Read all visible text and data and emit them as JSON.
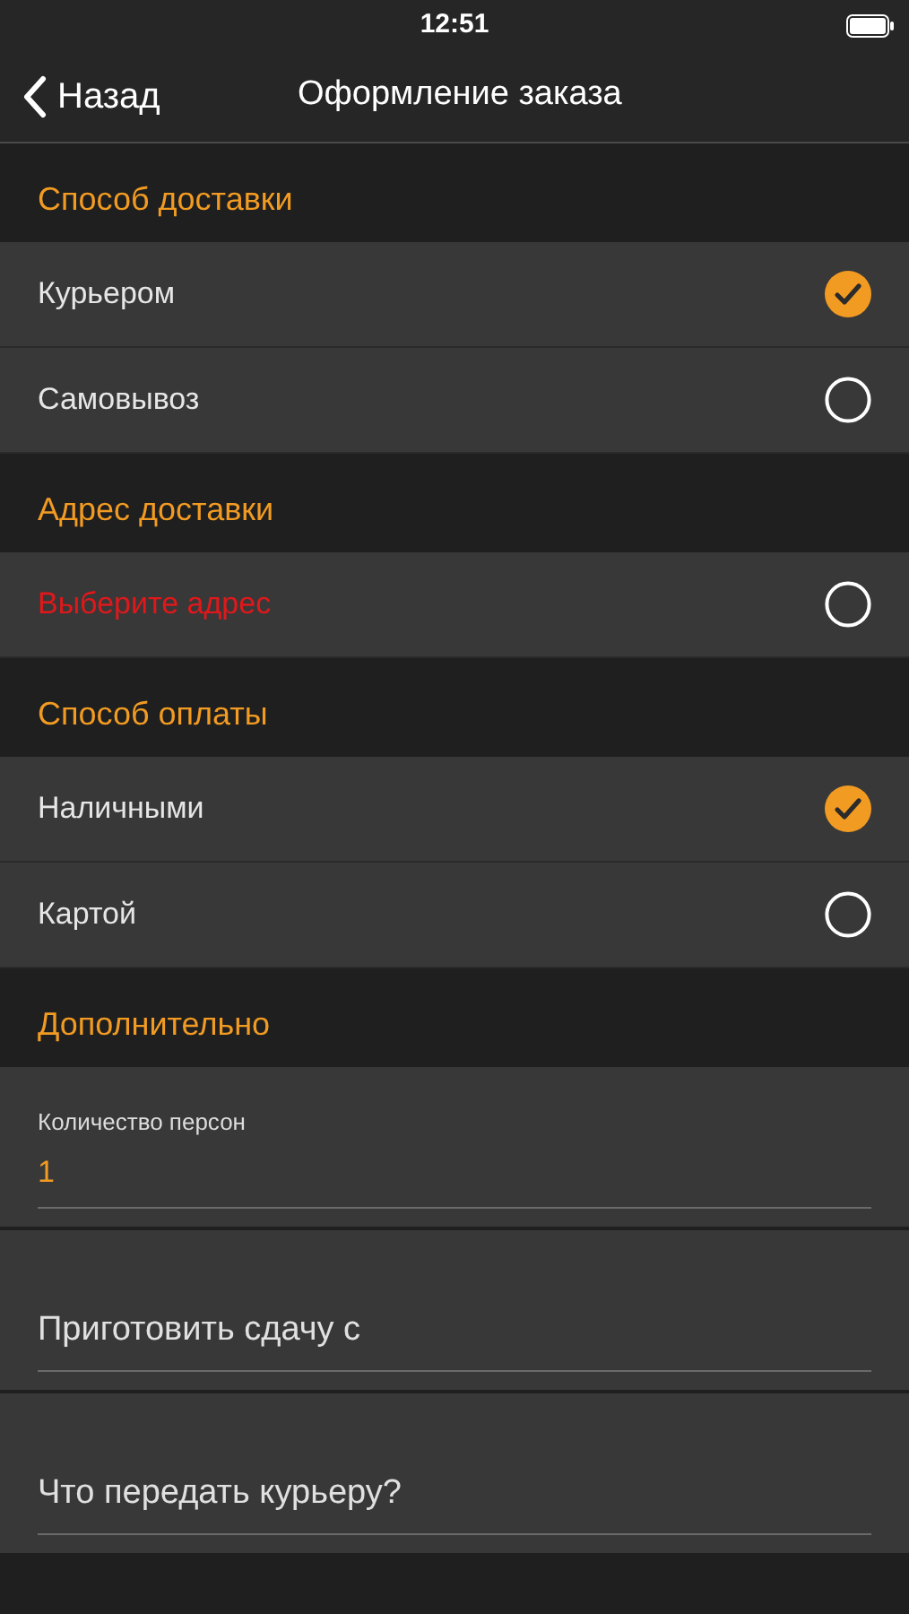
{
  "status_bar": {
    "time": "12:51"
  },
  "nav": {
    "back": "Назад",
    "title": "Оформление заказа"
  },
  "sections": [
    {
      "title": "Способ доставки",
      "rows": [
        {
          "kind": "option",
          "label": "Курьером",
          "selected": true
        },
        {
          "kind": "option",
          "label": "Самовывоз",
          "selected": false
        }
      ]
    },
    {
      "title": "Адрес доставки",
      "rows": [
        {
          "kind": "alert",
          "label": "Выберите адрес",
          "selected": false
        }
      ]
    },
    {
      "title": "Способ оплаты",
      "rows": [
        {
          "kind": "option",
          "label": "Наличными",
          "selected": true
        },
        {
          "kind": "option",
          "label": "Картой",
          "selected": false
        }
      ]
    }
  ],
  "extra": {
    "title": "Дополнительно",
    "fields": [
      {
        "label": "Количество персон",
        "value": "1"
      },
      {
        "placeholder": "Приготовить сдачу с"
      },
      {
        "placeholder": "Что передать курьеру?"
      }
    ]
  }
}
